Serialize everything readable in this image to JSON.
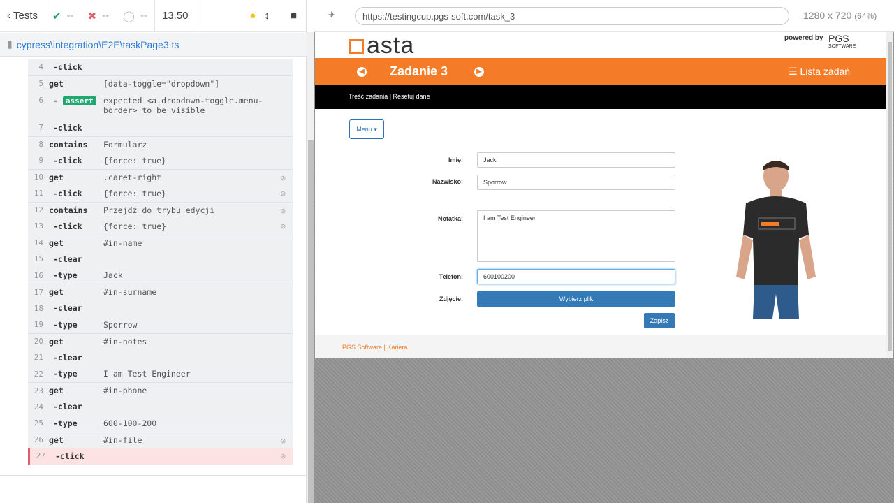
{
  "topbar": {
    "tests_label": "Tests",
    "passed": "--",
    "failed": "--",
    "pending": "--",
    "duration": "13.50"
  },
  "spec": {
    "path": "cypress\\integration\\E2E\\taskPage3.ts"
  },
  "commands": [
    {
      "num": "4",
      "name": "-click",
      "msg": "",
      "sub": true
    },
    {
      "num": "5",
      "name": "get",
      "msg": "[data-toggle=\"dropdown\"]",
      "sep": true
    },
    {
      "num": "6",
      "name": "-assert",
      "msg": "expected <a.dropdown-toggle.menu-border> to be visible",
      "assert": true
    },
    {
      "num": "7",
      "name": "-click",
      "msg": "",
      "sub": true
    },
    {
      "num": "8",
      "name": "contains",
      "msg": "Formularz",
      "sep": true
    },
    {
      "num": "9",
      "name": "-click",
      "msg": "{force: true}",
      "sub": true
    },
    {
      "num": "10",
      "name": "get",
      "msg": ".caret-right",
      "sep": true,
      "eye": true
    },
    {
      "num": "11",
      "name": "-click",
      "msg": "{force: true}",
      "sub": true,
      "eye": true
    },
    {
      "num": "12",
      "name": "contains",
      "msg": "Przejdź do trybu edycji",
      "sep": true,
      "eye": true
    },
    {
      "num": "13",
      "name": "-click",
      "msg": "{force: true}",
      "sub": true,
      "eye": true
    },
    {
      "num": "14",
      "name": "get",
      "msg": "#in-name",
      "sep": true
    },
    {
      "num": "15",
      "name": "-clear",
      "msg": "",
      "sub": true
    },
    {
      "num": "16",
      "name": "-type",
      "msg": "Jack",
      "sub": true
    },
    {
      "num": "17",
      "name": "get",
      "msg": "#in-surname",
      "sep": true
    },
    {
      "num": "18",
      "name": "-clear",
      "msg": "",
      "sub": true
    },
    {
      "num": "19",
      "name": "-type",
      "msg": "Sporrow",
      "sub": true
    },
    {
      "num": "20",
      "name": "get",
      "msg": "#in-notes",
      "sep": true
    },
    {
      "num": "21",
      "name": "-clear",
      "msg": "",
      "sub": true
    },
    {
      "num": "22",
      "name": "-type",
      "msg": "I am Test Engineer",
      "sub": true
    },
    {
      "num": "23",
      "name": "get",
      "msg": "#in-phone",
      "sep": true
    },
    {
      "num": "24",
      "name": "-clear",
      "msg": "",
      "sub": true
    },
    {
      "num": "25",
      "name": "-type",
      "msg": "600-100-200",
      "sub": true
    },
    {
      "num": "26",
      "name": "get",
      "msg": "#in-file",
      "sep": true,
      "eye": true
    },
    {
      "num": "27",
      "name": "-click",
      "msg": "",
      "sub": true,
      "eye": true,
      "fail": true
    }
  ],
  "aut": {
    "url": "https://testingcup.pgs-soft.com/task_3",
    "viewport": "1280 x 720",
    "zoom": "(64%)"
  },
  "page": {
    "logo": "asta",
    "powered_by": "powered by",
    "pgs_logo": "PGS",
    "pgs_logo_sub": "SOFTWARE",
    "task_title": "Zadanie 3",
    "task_list": "Lista zadań",
    "links": "Treść zadania | Resetuj dane",
    "menu": "Menu",
    "form": {
      "name_label": "Imię:",
      "name_value": "Jack",
      "surname_label": "Nazwisko:",
      "surname_value": "Sporrow",
      "notes_label": "Notatka:",
      "notes_value": "I am Test Engineer",
      "phone_label": "Telefon:",
      "phone_value": "600100200",
      "photo_label": "Zdjęcie:",
      "file_button": "Wybierz plik",
      "save_button": "Zapisz"
    },
    "footer": "PGS Software | Kariera"
  },
  "colors": {
    "brand": "#f47b27",
    "primary": "#337ab7",
    "pass": "#1e9e63",
    "fail": "#e25d6a"
  }
}
